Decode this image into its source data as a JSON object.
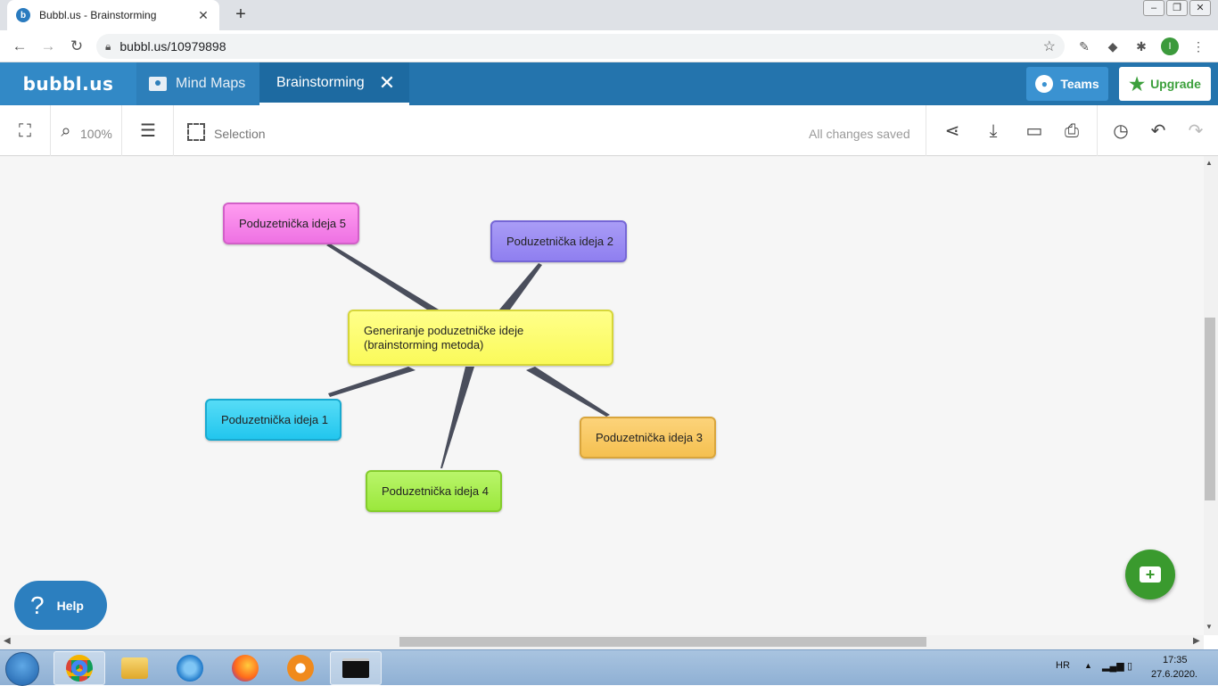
{
  "browser": {
    "tab_title": "Bubbl.us - Brainstorming",
    "new_tab": "+",
    "url": "bubbl.us/10979898",
    "profile_initial": "I"
  },
  "app": {
    "logo": "bubbl.us",
    "tabs": [
      {
        "label": "Mind Maps"
      },
      {
        "label": "Brainstorming"
      }
    ],
    "teams_label": "Teams",
    "upgrade_label": "Upgrade"
  },
  "toolbar": {
    "zoom": "100%",
    "selection_label": "Selection",
    "status": "All changes saved"
  },
  "map": {
    "center": {
      "line1": "Generiranje poduzetničke ideje",
      "line2": "(brainstorming metoda)"
    },
    "ideas": [
      {
        "label": "Poduzetnička ideja 1",
        "color": "#22c6ee"
      },
      {
        "label": "Poduzetnička ideja 2",
        "color": "#8f7ff0"
      },
      {
        "label": "Poduzetnička ideja 3",
        "color": "#f5c050"
      },
      {
        "label": "Poduzetnička ideja 4",
        "color": "#9be83c"
      },
      {
        "label": "Poduzetnička ideja 5",
        "color": "#ee72e3"
      }
    ],
    "center_color": "#fafa5a"
  },
  "help_label": "Help",
  "taskbar": {
    "language": "HR",
    "time": "17:35",
    "date": "27.6.2020."
  },
  "colors": {
    "appbar": "#2474ad",
    "upgrade_green": "#3ca03c"
  }
}
